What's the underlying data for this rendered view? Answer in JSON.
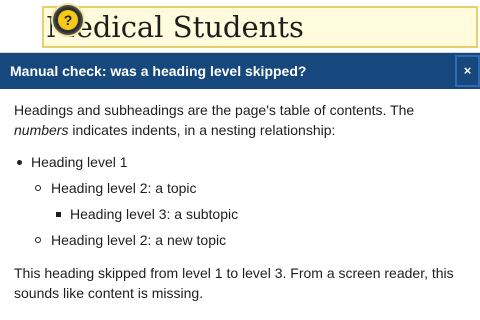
{
  "page": {
    "heading": "Medical Students"
  },
  "toggle": {
    "label": "?"
  },
  "tooltip": {
    "title": "Manual check: was a heading level skipped?",
    "close_label": "×",
    "intro_part1": "Headings and subheadings are the page's table of contents. The ",
    "intro_em": "numbers",
    "intro_part2": " indicates indents, in a nesting relationship:",
    "levels": [
      "Heading level 1",
      "Heading level 2: a topic",
      "Heading level 3: a subtopic",
      "Heading level 2: a new topic"
    ],
    "outro": "This heading skipped from level 1 to level 3. From a screen reader, this sounds like content is missing."
  },
  "colors": {
    "header_bg": "#16487e",
    "highlight_bg": "#fffbdc",
    "highlight_border": "#e7d06a",
    "toggle_yellow": "#f6c916"
  }
}
